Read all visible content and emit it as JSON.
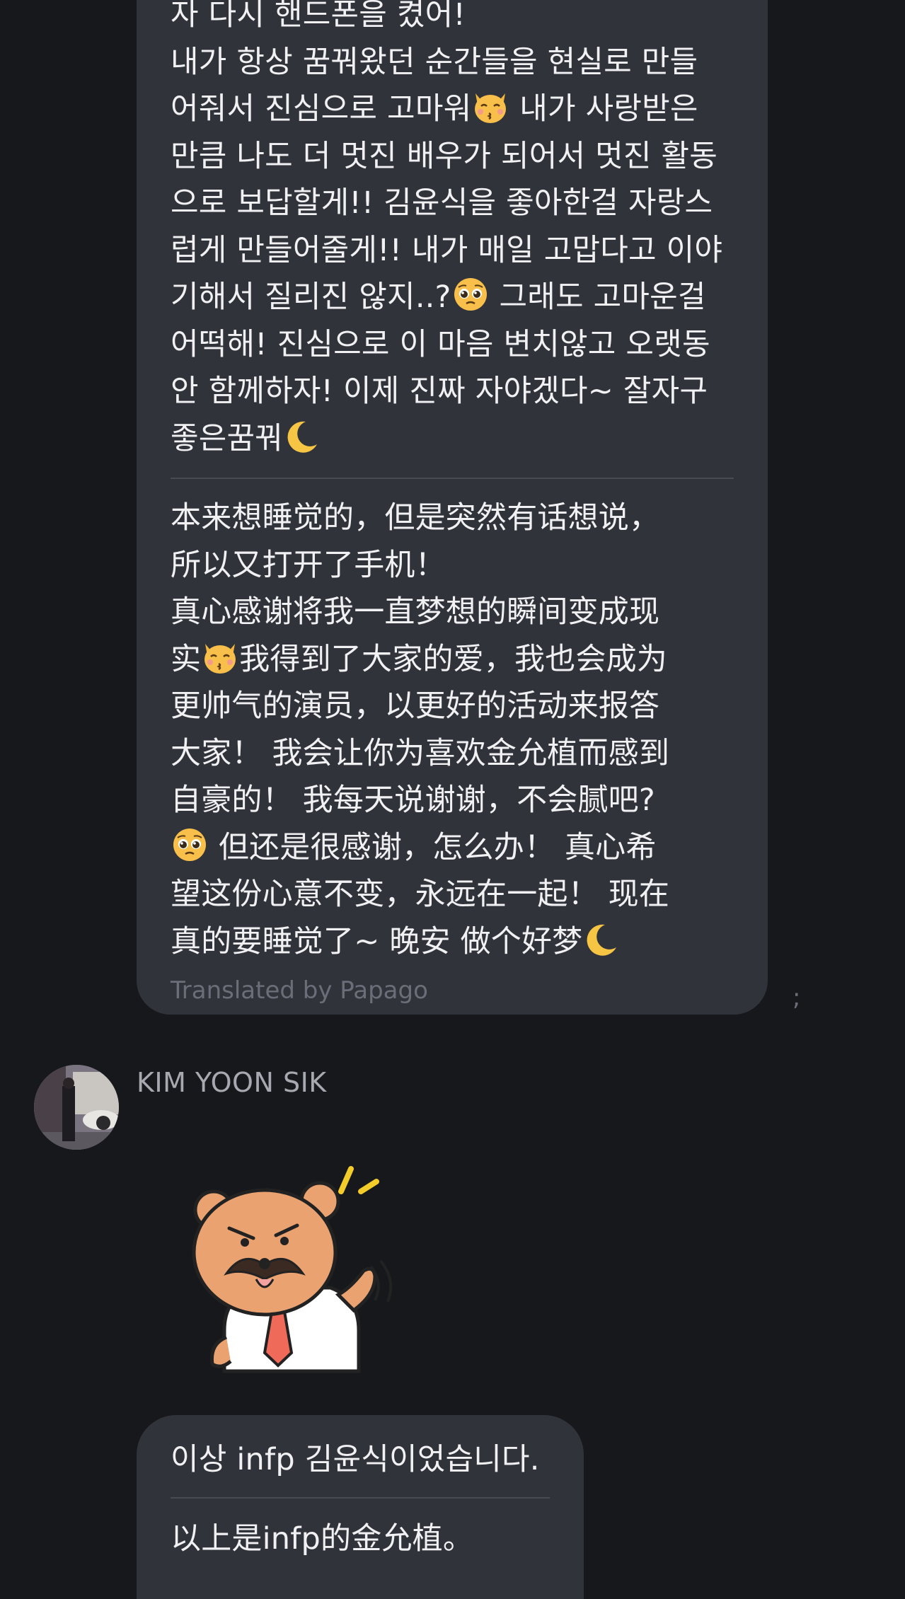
{
  "message_top": {
    "partial_line": "자 다시 핸드폰을 켰어!",
    "korean_lines": [
      "내가 항상 꿈꿔왔던 순간들을 현실로 만들",
      "어줘서 진심으로 고마워",
      " 내가 사랑받은",
      "만큼 나도 더 멋진 배우가 되어서 멋진 활동",
      "으로 보답할게!! 김윤식을 좋아한걸 자랑스",
      "럽게 만들어줄게!! 내가 매일 고맙다고 이야",
      "기해서 질리진 않지..?",
      " 그래도 고마운걸",
      "어떡해! 진심으로 이 마음 변치않고 오랫동",
      "안 함께하자! 이제 진짜 자야겠다~ 잘자구",
      "좋은꿈꿔"
    ],
    "chinese_lines": [
      "本来想睡觉的，但是突然有话想说，",
      "所以又打开了手机！",
      "真心感谢将我一直梦想的瞬间变成现",
      "实",
      "我得到了大家的爱，我也会成为",
      "更帅气的演员，以更好的活动来报答",
      "大家！ 我会让你为喜欢金允植而感到",
      "自豪的！ 我每天说谢谢，不会腻吧?",
      " 但还是很感谢，怎么办！ 真心希",
      "望这份心意不变，永远在一起！ 现在",
      "真的要睡觉了~ 晚安 做个好梦"
    ],
    "translated_label": "Translated by Papago"
  },
  "partial_right_text": ";",
  "sender": {
    "name": "KIM YOON SIK"
  },
  "sticker": {
    "icon": "bear-mustache-sticker"
  },
  "message_bottom": {
    "korean": "이상 infp 김윤식이었습니다.",
    "chinese": "以上是infp的金允植。"
  },
  "colors": {
    "background": "#17181c",
    "bubble": "#31333b",
    "text": "#f1f1f3",
    "muted": "#6b6e78"
  }
}
